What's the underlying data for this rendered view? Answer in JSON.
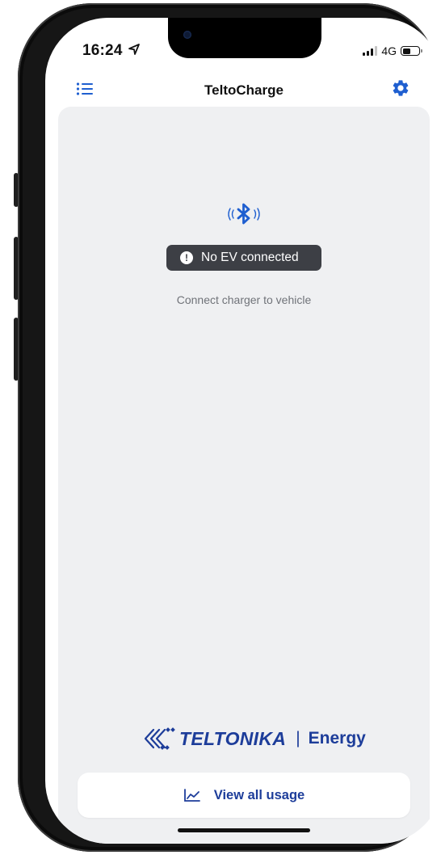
{
  "status_bar": {
    "time": "16:24",
    "network": "4G",
    "battery_level": 0.55
  },
  "navbar": {
    "title": "TeltoCharge"
  },
  "main": {
    "connection_status": "No EV connected",
    "hint": "Connect charger to vehicle"
  },
  "brand": {
    "name": "TELTONIKA",
    "separator": "|",
    "product": "Energy"
  },
  "footer": {
    "usage_button_label": "View all usage"
  },
  "colors": {
    "accent": "#1d3d9a",
    "bluetooth": "#1f5fd0",
    "background": "#eff0f2",
    "badge": "#3d3f45"
  },
  "icons": {
    "menu": "list-menu-icon",
    "settings": "gear-icon",
    "bluetooth": "bluetooth-signal-icon",
    "alert": "exclamation-icon",
    "usage": "line-chart-icon"
  }
}
